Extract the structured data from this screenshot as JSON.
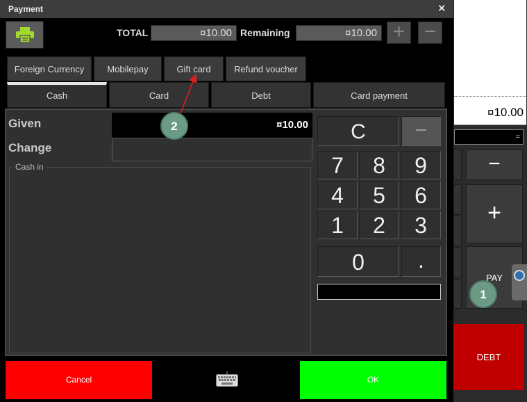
{
  "dialog": {
    "title": "Payment",
    "close_symbol": "✕"
  },
  "totals": {
    "total_label": "TOTAL",
    "total_value": "¤10.00",
    "remaining_label": "Remaining",
    "remaining_value": "¤10.00",
    "plus_symbol": "+",
    "minus_symbol": "−"
  },
  "tabs_row1": [
    "Foreign Currency",
    "Mobilepay",
    "Gift card",
    "Refund voucher"
  ],
  "tabs_row2": [
    "Cash",
    "Card",
    "Debt",
    "Card payment"
  ],
  "cash": {
    "given_label": "Given",
    "given_value": "¤10.00",
    "change_label": "Change",
    "cash_in_label": "Cash in"
  },
  "keypad": {
    "clear": "C",
    "minus": "−",
    "keys": [
      "7",
      "8",
      "9",
      "4",
      "5",
      "6",
      "1",
      "2",
      "3"
    ],
    "zero": "0",
    "dot": "."
  },
  "footer": {
    "cancel_label": "Cancel",
    "ok_label": "OK",
    "keyboard_icon": "keyboard-icon"
  },
  "background_app": {
    "receipt_total": "¤10.00",
    "input_value": "=",
    "minus_label": "−",
    "plus_label": "+",
    "pay_label": "PAY",
    "debt_label": "DEBT"
  },
  "markers": [
    "1",
    "2"
  ],
  "colors": {
    "cancel": "#ff0000",
    "ok": "#00ff00",
    "debt": "#c00000",
    "print_icon": "#a3d82c",
    "marker": "#6b9b85",
    "arrow": "#e02020"
  }
}
